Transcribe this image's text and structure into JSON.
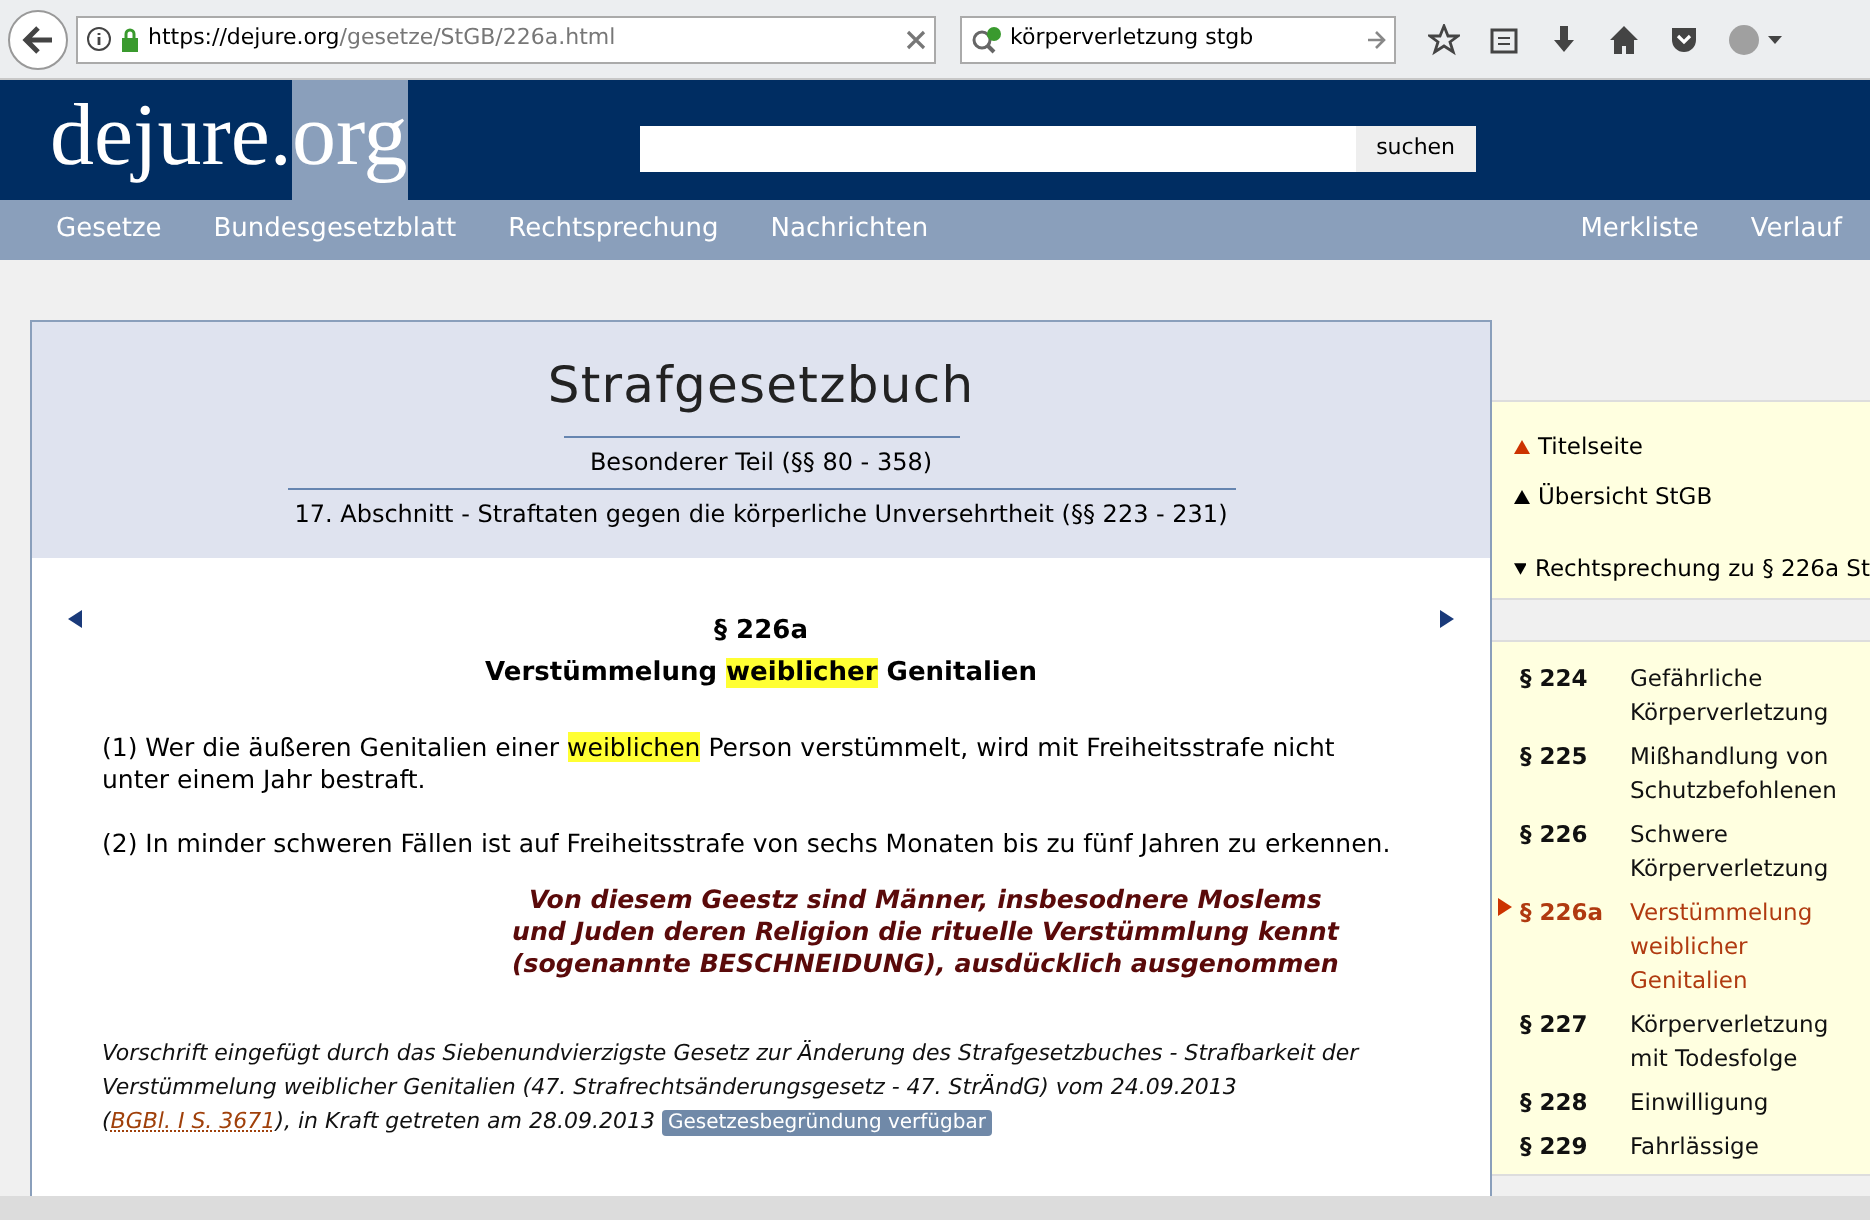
{
  "browser": {
    "url_host": "https://dejure.org",
    "url_path": "/gesetze/StGB/226a.html",
    "search": "körperverletzung stgb"
  },
  "site": {
    "logo_main": "dejure.",
    "logo_accent": "org",
    "search_button": "suchen"
  },
  "nav": {
    "left": [
      "Gesetze",
      "Bundesgesetzblatt",
      "Rechtsprechung",
      "Nachrichten"
    ],
    "right": [
      "Merkliste",
      "Verlauf"
    ]
  },
  "law": {
    "title": "Strafgesetzbuch",
    "part": "Besonderer Teil (§§ 80 - 358)",
    "section": "17. Abschnitt - Straftaten gegen die körperliche Unversehrtheit (§§ 223 - 231)",
    "number": "§ 226a",
    "heading": [
      {
        "text": "Verstümmelung ",
        "highlight": false
      },
      {
        "text": "weiblicher",
        "highlight": true
      },
      {
        "text": " Genitalien",
        "highlight": false
      }
    ],
    "paragraphs": [
      [
        {
          "text": "(1) Wer die äußeren Genitalien einer ",
          "highlight": false
        },
        {
          "text": "weiblichen",
          "highlight": true
        },
        {
          "text": " Person verstümmelt, wird mit Freiheitsstrafe nicht unter einem Jahr bestraft.",
          "highlight": false
        }
      ],
      [
        {
          "text": "(2) In minder schweren Fällen ist auf Freiheitsstrafe von sechs Monaten bis zu fünf Jahren zu erkennen.",
          "highlight": false
        }
      ]
    ],
    "remark": [
      "Von diesem Geestz sind Männer, insbesodnere Moslems",
      "und Juden deren Religion die rituelle Verstümmlung kennt",
      "(sogenannte BESCHNEIDUNG), ausdücklich ausgenommen"
    ],
    "footnote": [
      {
        "kind": "text",
        "text": "Vorschrift eingefügt durch das Siebenundvierzigste Gesetz zur Änderung des Strafgesetzbuches - Strafbarkeit der Verstümmelung weiblicher Genitalien (47. Strafrechtsänderungsgesetz - 47. StrÄndG) vom 24.09.2013 ("
      },
      {
        "kind": "link",
        "text": "BGBl. I S. 3671"
      },
      {
        "kind": "text",
        "text": "), in Kraft getreten am 28.09.2013 "
      },
      {
        "kind": "badge",
        "text": "Gesetzesbegründung verfügbar"
      }
    ]
  },
  "side_links": [
    {
      "text": "Titelseite",
      "kind": "up",
      "color": "#cc3300"
    },
    {
      "text": "Übersicht StGB",
      "kind": "up",
      "color": "#000000"
    },
    {
      "text": "Rechtsprechung zu § 226a St",
      "kind": "down",
      "color": "#000000"
    }
  ],
  "toc": [
    {
      "number": "§ 224",
      "title": "Gefährliche Körperverletzung",
      "selected": false
    },
    {
      "number": "§ 225",
      "title": "Mißhandlung von Schutzbefohlenen",
      "selected": false
    },
    {
      "number": "§ 226",
      "title": "Schwere Körperverletzung",
      "selected": false
    },
    {
      "number": "§ 226a",
      "title": "Verstümmelung weiblicher Genitalien",
      "selected": true
    },
    {
      "number": "§ 227",
      "title": "Körperverletzung mit Todesfolge",
      "selected": false
    },
    {
      "number": "§ 228",
      "title": "Einwilligung",
      "selected": false
    },
    {
      "number": "§ 229",
      "title": "Fahrlässige",
      "selected": false
    }
  ]
}
